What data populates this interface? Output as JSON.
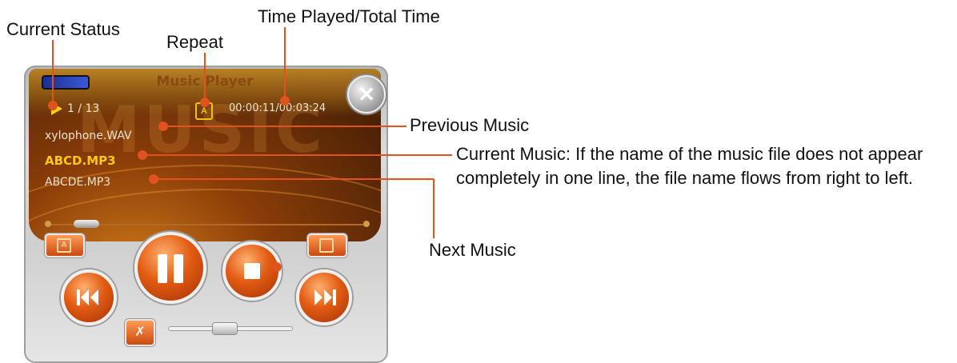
{
  "annotations": {
    "current_status": "Current Status",
    "repeat": "Repeat",
    "time_played": "Time Played/Total Time",
    "previous_music": "Previous Music",
    "current_music": "Current Music: If the name of the music file does not appear completely in one line, the file name flows from right to left.",
    "next_music": "Next Music"
  },
  "player": {
    "title": "Music Player",
    "watermark": "MUSIC",
    "track_position": "1 / 13",
    "repeat_icon": "A",
    "time": "00:00:11/00:03:24",
    "previous_track": "xylophone.WAV",
    "current_track": "ABCD.MP3",
    "next_track": "ABCDE.MP3",
    "close_label": "✕",
    "progress": 0.12,
    "volume": 0.45
  },
  "colors": {
    "leader_line": "#e0521e",
    "accent_orange": "#e25b12",
    "current_track": "#ffc81a"
  },
  "icons": {
    "status": "play-status-icon",
    "repeat": "repeat-icon",
    "playlist": "playlist-icon",
    "pause": "pause-icon",
    "stop": "stop-icon",
    "prev": "previous-track-icon",
    "next": "next-track-icon",
    "mute": "mute-icon",
    "close": "close-icon"
  }
}
